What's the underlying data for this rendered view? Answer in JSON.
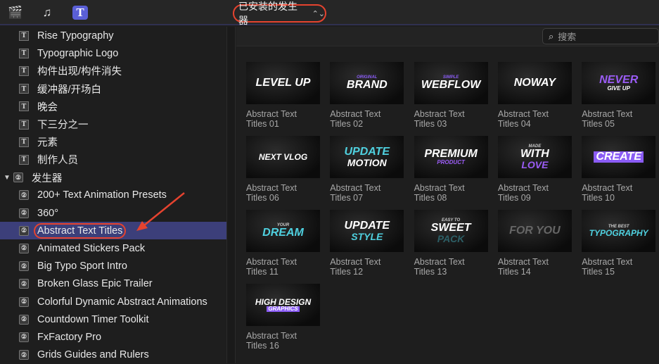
{
  "topbar": {
    "icons": [
      "clapper-star-icon",
      "music-photo-icon",
      "titles-generators-icon"
    ],
    "library_select": "已安装的发生器",
    "accent": "#e5432f"
  },
  "search": {
    "placeholder": "搜索"
  },
  "sidebar": {
    "items": [
      {
        "label": "Rise Typography",
        "type": "title"
      },
      {
        "label": "Typographic Logo",
        "type": "title"
      },
      {
        "label": "构件出现/构件消失",
        "type": "title"
      },
      {
        "label": "缓冲器/开场白",
        "type": "title"
      },
      {
        "label": "晚会",
        "type": "title"
      },
      {
        "label": "下三分之一",
        "type": "title"
      },
      {
        "label": "元素",
        "type": "title"
      },
      {
        "label": "制作人员",
        "type": "title"
      },
      {
        "label": "发生器",
        "type": "group"
      },
      {
        "label": "200+ Text Animation Presets",
        "type": "gen"
      },
      {
        "label": "360°",
        "type": "gen"
      },
      {
        "label": "Abstract Text Titles",
        "type": "gen",
        "selected": true
      },
      {
        "label": "Animated Stickers Pack",
        "type": "gen"
      },
      {
        "label": "Big Typo Sport Intro",
        "type": "gen"
      },
      {
        "label": "Broken Glass Epic Trailer",
        "type": "gen"
      },
      {
        "label": "Colorful Dynamic Abstract Animations",
        "type": "gen"
      },
      {
        "label": "Countdown Timer Toolkit",
        "type": "gen"
      },
      {
        "label": "FxFactory Pro",
        "type": "gen"
      },
      {
        "label": "Grids Guides and Rulers",
        "type": "gen"
      }
    ],
    "selected_color": "#3c3f7a"
  },
  "tiles": [
    {
      "line1": "Abstract Text",
      "line2": "Titles 01",
      "t1": "LEVEL UP",
      "t2": "",
      "c2": "#4fd1e0"
    },
    {
      "line1": "Abstract Text",
      "line2": "Titles 02",
      "t0": "ORIGINAL",
      "t1": "BRAND",
      "c0": "#8b5cf6"
    },
    {
      "line1": "Abstract Text",
      "line2": "Titles 03",
      "t0": "SIMPLE",
      "t1": "WEBFLOW",
      "c0": "#8b5cf6"
    },
    {
      "line1": "Abstract Text",
      "line2": "Titles 04",
      "t1": "NOWAY"
    },
    {
      "line1": "Abstract Text",
      "line2": "Titles 05",
      "t1": "NEVER",
      "t2": "GIVE UP",
      "c1": "#9b5cf6"
    },
    {
      "line1": "Abstract Text",
      "line2": "Titles 06",
      "t1": "NEXT VLOG"
    },
    {
      "line1": "Abstract Text",
      "line2": "Titles 07",
      "t1": "UPDATE",
      "t2": "MOTION",
      "c1": "#4fd1e0"
    },
    {
      "line1": "Abstract Text",
      "line2": "Titles 08",
      "t1": "PREMIUM",
      "t2": "PRODUCT",
      "c2": "#9b5cf6"
    },
    {
      "line1": "Abstract Text",
      "line2": "Titles 09",
      "t0": "MADE",
      "t1": "WITH",
      "t2": "LOVE",
      "c2": "#9b5cf6"
    },
    {
      "line1": "Abstract Text",
      "line2": "Titles 10",
      "t1": "CREATE",
      "c1": "#ffffff",
      "b1": "#8b5cf6"
    },
    {
      "line1": "Abstract Text",
      "line2": "Titles 11",
      "t0": "YOUR",
      "t1": "DREAM",
      "c1": "#4fd1e0"
    },
    {
      "line1": "Abstract Text",
      "line2": "Titles 12",
      "t1": "UPDATE",
      "t2": "STYLE",
      "c2": "#4fd1e0"
    },
    {
      "line1": "Abstract Text",
      "line2": "Titles 13",
      "t0": "EASY TO",
      "t1": "SWEET",
      "t2": "PACK",
      "c2": "#2c5f66"
    },
    {
      "line1": "Abstract Text",
      "line2": "Titles 14",
      "t1": "FOR YOU",
      "c1": "#666666"
    },
    {
      "line1": "Abstract Text",
      "line2": "Titles 15",
      "t0": "THE BEST",
      "t1": "TYPOGRAPHY",
      "c1": "#4fd1e0"
    },
    {
      "line1": "Abstract Text",
      "line2": "Titles 16",
      "t1": "HIGH DESIGN",
      "t2": "GRAPHICS",
      "c2": "#ffffff",
      "b2": "#8b5cf6"
    }
  ]
}
